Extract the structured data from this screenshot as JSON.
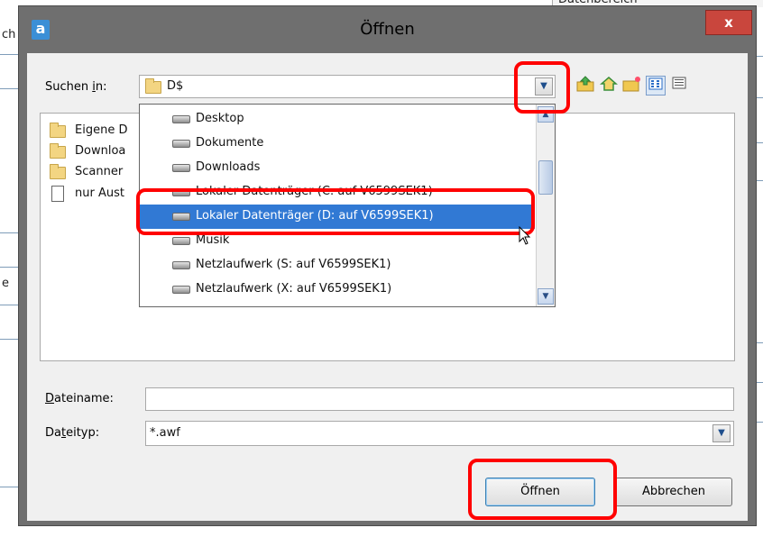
{
  "background": {
    "top_label": "Datenbereich",
    "frag_ch": "ch",
    "frag_e": "e"
  },
  "dialog": {
    "title": "Öffnen",
    "app_icon_letter": "a",
    "close_label": "x"
  },
  "lookin": {
    "label_before": "Suchen ",
    "label_ul": "i",
    "label_after": "n:",
    "value": "D$",
    "toolbar_icons": [
      "up-folder-icon",
      "home-icon",
      "new-folder-icon",
      "list-view-icon",
      "details-view-icon"
    ]
  },
  "file_list": {
    "items": [
      {
        "name": "Eigene D",
        "icon": "folder-icon"
      },
      {
        "name": "Downloa",
        "icon": "folder-icon"
      },
      {
        "name": "Scanner",
        "icon": "folder-icon"
      },
      {
        "name": "nur Aust",
        "icon": "document-icon"
      }
    ]
  },
  "dropdown": {
    "items": [
      {
        "label": "Desktop"
      },
      {
        "label": "Dokumente"
      },
      {
        "label": "Downloads"
      },
      {
        "label": "Lokaler Datenträger (C: auf V6599SEK1)"
      },
      {
        "label": "Lokaler Datenträger (D: auf V6599SEK1)",
        "selected": true
      },
      {
        "label": "Musik"
      },
      {
        "label": "Netzlaufwerk (S: auf V6599SEK1)"
      },
      {
        "label": "Netzlaufwerk (X: auf V6599SEK1)"
      }
    ]
  },
  "filename": {
    "label_ul": "D",
    "label_after": "ateiname:",
    "value": ""
  },
  "filetype": {
    "label_before": "Da",
    "label_ul": "t",
    "label_after": "eityp:",
    "value": "*.awf"
  },
  "buttons": {
    "open": "Öffnen",
    "cancel": "Abbrechen"
  },
  "colors": {
    "annotation": "#ff0000",
    "selection": "#3179d4",
    "title_bar": "#6f6f6f"
  }
}
